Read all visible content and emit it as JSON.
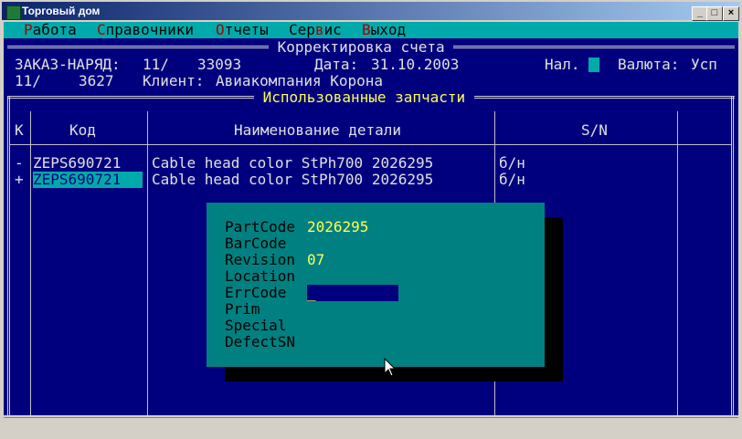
{
  "window": {
    "title": "Торговый дом"
  },
  "menu": {
    "items": [
      {
        "hot": "Р",
        "rest": "абота",
        "pre": ""
      },
      {
        "hot": "С",
        "rest": "правочники",
        "pre": ""
      },
      {
        "hot": "О",
        "rest": "тчеты",
        "pre": ""
      },
      {
        "pre": "Сер",
        "hot": "в",
        "rest": "ис"
      },
      {
        "hot": "В",
        "rest": "ыход",
        "pre": ""
      }
    ]
  },
  "header": {
    "frame_title": " Корректировка счета ",
    "order_label": "ЗАКАЗ-НАРЯД:",
    "order_num_a": "11/",
    "order_num_b": "33093",
    "date_label": "Дата:",
    "date_value": "31.10.2003",
    "nal_label": "Нал.",
    "currency_label": "Валюта:",
    "currency_value": "Усп",
    "sub_a": "11/",
    "sub_b": "3627",
    "client_label": "Клиент:",
    "client_value": "Авиакомпания Корона"
  },
  "parts": {
    "section_title": " Использованные запчасти ",
    "columns": {
      "k": "К",
      "code": "Код",
      "name": "Наименование детали",
      "sn": "S/N"
    },
    "rows": [
      {
        "mark": "-",
        "code": "ZEPS690721",
        "name": "Cable head color StPh700 2026295",
        "sn": "б/н"
      },
      {
        "mark": "+",
        "code": "ZEPS690721",
        "name": "Cable head color StPh700 2026295",
        "sn": "б/н"
      }
    ]
  },
  "dialog": {
    "partcode_label": "PartCode",
    "partcode_value": "2026295",
    "barcode_label": "BarCode",
    "revision_label": "Revision",
    "revision_value": "07",
    "location_label": "Location",
    "errcode_label": "ErrCode",
    "errcode_value": "_",
    "prim_label": "Prim",
    "special_label": "Special",
    "defectsn_label": "DefectSN"
  },
  "colors": {
    "console_bg": "#00007f",
    "dialog_bg": "#008080",
    "highlight": "#00aaaa",
    "value_yellow": "#ffff55"
  }
}
